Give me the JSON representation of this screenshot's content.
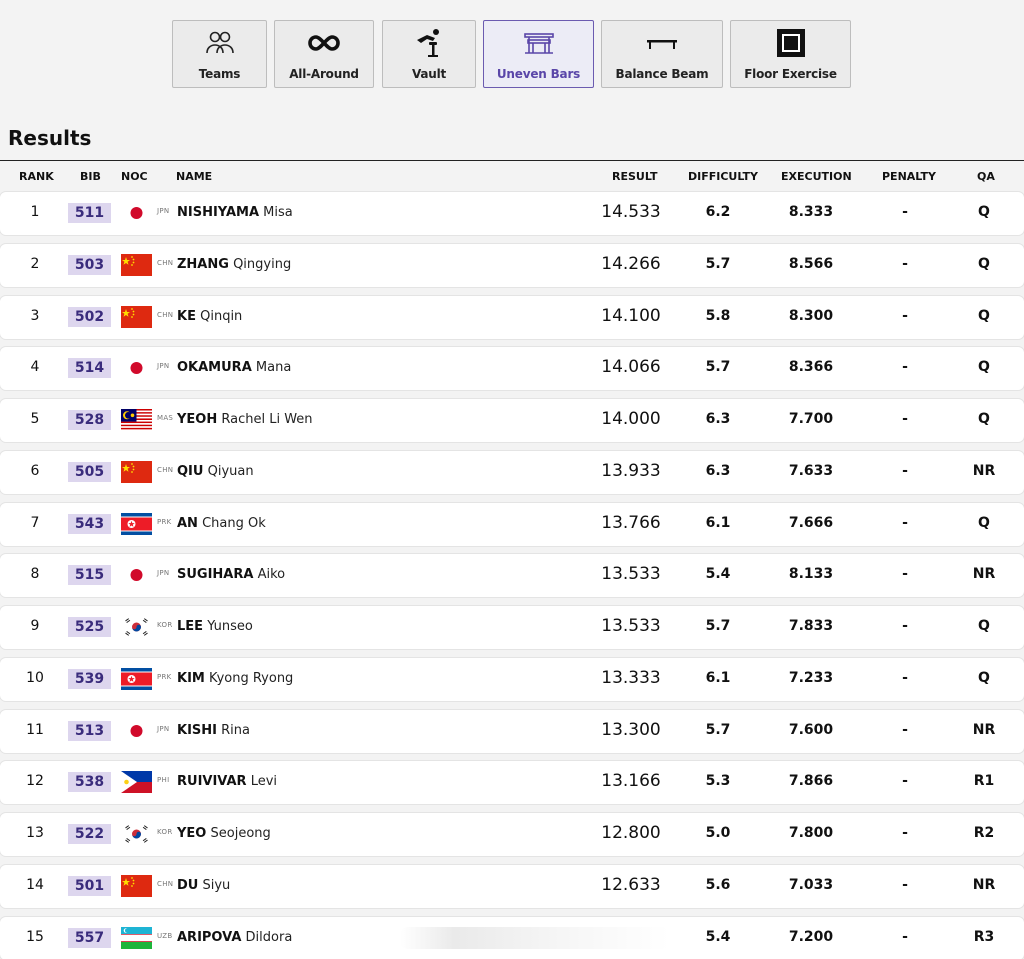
{
  "tabs": [
    {
      "label": "Teams",
      "icon": "teams-icon",
      "active": false
    },
    {
      "label": "All-Around",
      "icon": "infinity-icon",
      "active": false
    },
    {
      "label": "Vault",
      "icon": "vault-icon",
      "active": false
    },
    {
      "label": "Uneven Bars",
      "icon": "uneven-bars-icon",
      "active": true
    },
    {
      "label": "Balance Beam",
      "icon": "balance-beam-icon",
      "active": false
    },
    {
      "label": "Floor Exercise",
      "icon": "floor-exercise-icon",
      "active": false
    }
  ],
  "results": {
    "title": "Results",
    "columns": {
      "rank": "RANK",
      "bib": "BIB",
      "noc": "NOC",
      "name": "NAME",
      "result": "RESULT",
      "difficulty": "DIFFICULTY",
      "execution": "EXECUTION",
      "penalty": "PENALTY",
      "qa": "QA"
    },
    "rows": [
      {
        "rank": "1",
        "bib": "511",
        "noc": "JPN",
        "surname": "NISHIYAMA",
        "given": "Misa",
        "result": "14.533",
        "difficulty": "6.2",
        "execution": "8.333",
        "penalty": "-",
        "qa": "Q"
      },
      {
        "rank": "2",
        "bib": "503",
        "noc": "CHN",
        "surname": "ZHANG",
        "given": "Qingying",
        "result": "14.266",
        "difficulty": "5.7",
        "execution": "8.566",
        "penalty": "-",
        "qa": "Q"
      },
      {
        "rank": "3",
        "bib": "502",
        "noc": "CHN",
        "surname": "KE",
        "given": "Qinqin",
        "result": "14.100",
        "difficulty": "5.8",
        "execution": "8.300",
        "penalty": "-",
        "qa": "Q"
      },
      {
        "rank": "4",
        "bib": "514",
        "noc": "JPN",
        "surname": "OKAMURA",
        "given": "Mana",
        "result": "14.066",
        "difficulty": "5.7",
        "execution": "8.366",
        "penalty": "-",
        "qa": "Q"
      },
      {
        "rank": "5",
        "bib": "528",
        "noc": "MAS",
        "surname": "YEOH",
        "given": "Rachel Li Wen",
        "result": "14.000",
        "difficulty": "6.3",
        "execution": "7.700",
        "penalty": "-",
        "qa": "Q"
      },
      {
        "rank": "6",
        "bib": "505",
        "noc": "CHN",
        "surname": "QIU",
        "given": "Qiyuan",
        "result": "13.933",
        "difficulty": "6.3",
        "execution": "7.633",
        "penalty": "-",
        "qa": "NR"
      },
      {
        "rank": "7",
        "bib": "543",
        "noc": "PRK",
        "surname": "AN",
        "given": "Chang Ok",
        "result": "13.766",
        "difficulty": "6.1",
        "execution": "7.666",
        "penalty": "-",
        "qa": "Q"
      },
      {
        "rank": "8",
        "bib": "515",
        "noc": "JPN",
        "surname": "SUGIHARA",
        "given": "Aiko",
        "result": "13.533",
        "difficulty": "5.4",
        "execution": "8.133",
        "penalty": "-",
        "qa": "NR"
      },
      {
        "rank": "9",
        "bib": "525",
        "noc": "KOR",
        "surname": "LEE",
        "given": "Yunseo",
        "result": "13.533",
        "difficulty": "5.7",
        "execution": "7.833",
        "penalty": "-",
        "qa": "Q"
      },
      {
        "rank": "10",
        "bib": "539",
        "noc": "PRK",
        "surname": "KIM",
        "given": "Kyong Ryong",
        "result": "13.333",
        "difficulty": "6.1",
        "execution": "7.233",
        "penalty": "-",
        "qa": "Q"
      },
      {
        "rank": "11",
        "bib": "513",
        "noc": "JPN",
        "surname": "KISHI",
        "given": "Rina",
        "result": "13.300",
        "difficulty": "5.7",
        "execution": "7.600",
        "penalty": "-",
        "qa": "NR"
      },
      {
        "rank": "12",
        "bib": "538",
        "noc": "PHI",
        "surname": "RUIVIVAR",
        "given": "Levi",
        "result": "13.166",
        "difficulty": "5.3",
        "execution": "7.866",
        "penalty": "-",
        "qa": "R1"
      },
      {
        "rank": "13",
        "bib": "522",
        "noc": "KOR",
        "surname": "YEO",
        "given": "Seojeong",
        "result": "12.800",
        "difficulty": "5.0",
        "execution": "7.800",
        "penalty": "-",
        "qa": "R2"
      },
      {
        "rank": "14",
        "bib": "501",
        "noc": "CHN",
        "surname": "DU",
        "given": "Siyu",
        "result": "12.633",
        "difficulty": "5.6",
        "execution": "7.033",
        "penalty": "-",
        "qa": "NR"
      },
      {
        "rank": "15",
        "bib": "557",
        "noc": "UZB",
        "surname": "ARIPOVA",
        "given": "Dildora",
        "result": "",
        "difficulty": "5.4",
        "execution": "7.200",
        "penalty": "-",
        "qa": "R3"
      }
    ]
  },
  "colors": {
    "accent": "#5a46a8",
    "bib_bg": "#ddd6ee",
    "bib_text": "#3a2c7c"
  }
}
